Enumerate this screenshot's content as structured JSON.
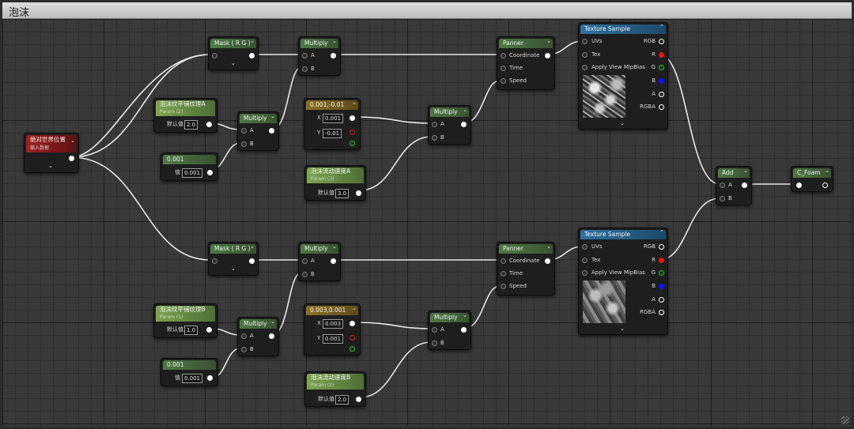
{
  "window": {
    "title": "泡沫"
  },
  "nodes": {
    "world_position": {
      "title": "绝对世界位置",
      "subtitle": "输入数据"
    },
    "mask1": {
      "title": "Mask ( R G )"
    },
    "mask2": {
      "title": "Mask ( R G )"
    },
    "multiply1": {
      "title": "Multiply",
      "pin_a": "A",
      "pin_b": "B"
    },
    "multiply2": {
      "title": "Multiply",
      "pin_a": "A",
      "pin_b": "B"
    },
    "multiply3": {
      "title": "Multiply",
      "pin_a": "A",
      "pin_b": "B"
    },
    "multiply4": {
      "title": "Multiply",
      "pin_a": "A",
      "pin_b": "B"
    },
    "multiply5": {
      "title": "Multiply",
      "pin_a": "A",
      "pin_b": "B"
    },
    "multiply6": {
      "title": "Multiply",
      "pin_a": "A",
      "pin_b": "B"
    },
    "param_tile_a": {
      "title": "泡沫纹平铺纹理A",
      "subtitle": "Param (2)",
      "value_label": "默认值",
      "value": "2.0"
    },
    "param_tile_b": {
      "title": "泡沫纹平铺纹理B",
      "subtitle": "Param (1)",
      "value_label": "默认值",
      "value": "1.0"
    },
    "param_speed_a": {
      "title": "泡沫流动速度A",
      "subtitle": "Param (3)",
      "value_label": "默认值",
      "value": "3.0"
    },
    "param_speed_b": {
      "title": "泡沫流动速度B",
      "subtitle": "Param (2)",
      "value_label": "默认值",
      "value": "2.0"
    },
    "const1": {
      "title": "0.001",
      "value_label": "值",
      "value": "0.001"
    },
    "const2": {
      "title": "0.001",
      "value_label": "值",
      "value": "0.001"
    },
    "vec2a": {
      "title": "0.001,-0.01",
      "x_label": "X",
      "x_value": "0.001",
      "y_label": "Y",
      "y_value": "-0.01"
    },
    "vec2b": {
      "title": "0.003,0.001",
      "x_label": "X",
      "x_value": "0.003",
      "y_label": "Y",
      "y_value": "0.001"
    },
    "panner1": {
      "title": "Panner",
      "coordinate": "Coordinate",
      "time": "Time",
      "speed": "Speed"
    },
    "panner2": {
      "title": "Panner",
      "coordinate": "Coordinate",
      "time": "Time",
      "speed": "Speed"
    },
    "texture1": {
      "title": "Texture Sample",
      "uvs": "UVs",
      "tex": "Tex",
      "mipbias": "Apply View MipBias",
      "rgb": "RGB",
      "r": "R",
      "g": "G",
      "b": "B",
      "a": "A",
      "rgba": "RGBA"
    },
    "texture2": {
      "title": "Texture Sample",
      "uvs": "UVs",
      "tex": "Tex",
      "mipbias": "Apply View MipBias",
      "rgb": "RGB",
      "r": "R",
      "g": "G",
      "b": "B",
      "a": "A",
      "rgba": "RGBA"
    },
    "add": {
      "title": "Add",
      "pin_a": "A",
      "pin_b": "B"
    },
    "foam_output": {
      "title": "C_Foam"
    }
  },
  "colors": {
    "graph_bg": "#393939",
    "wire": "#e6e6e6",
    "param_header": "#7da64e",
    "function_header": "#4e7a44",
    "vector_header": "#8c7024",
    "texture_header": "#3072a0",
    "input_header": "#a42020",
    "pin_red": "#e01818",
    "pin_green": "#20d020",
    "pin_blue": "#1010ff"
  }
}
